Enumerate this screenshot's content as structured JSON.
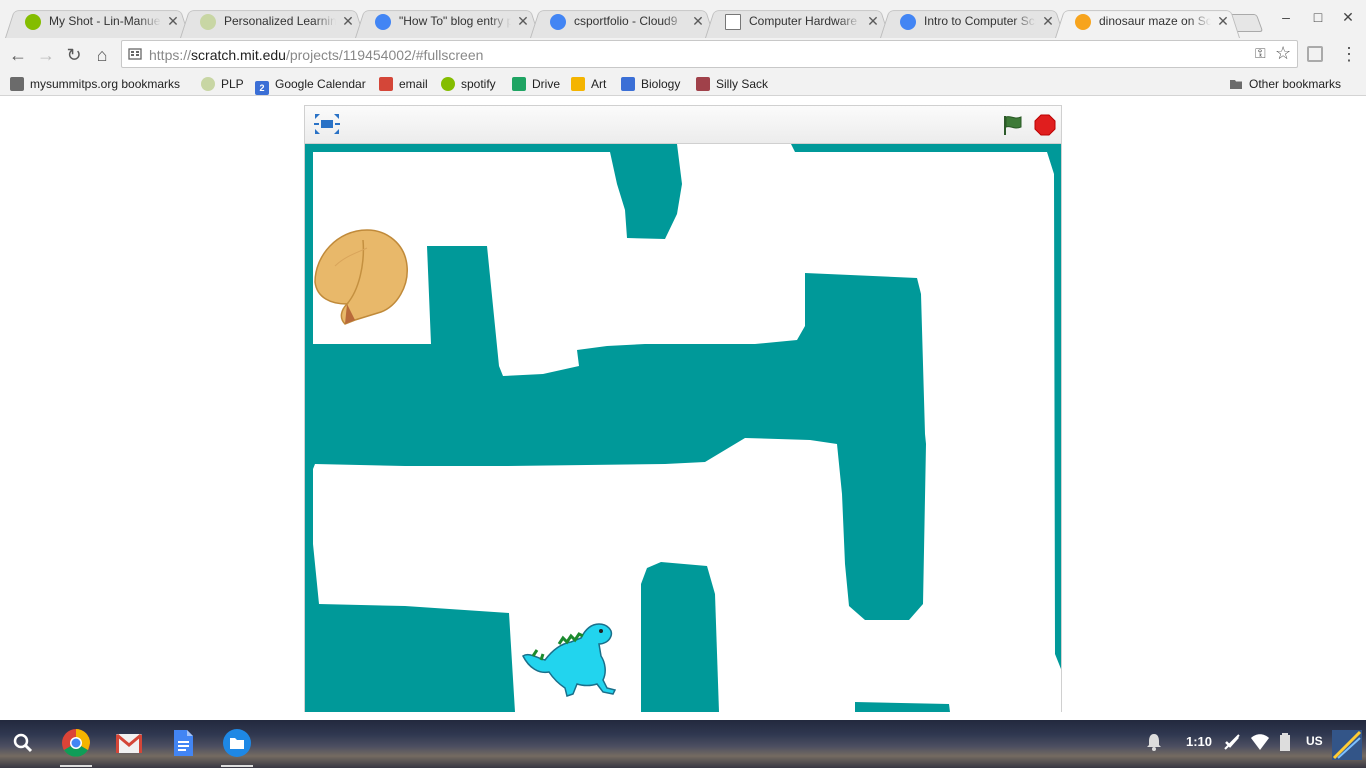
{
  "browser": {
    "tabs": [
      {
        "title": "My Shot - Lin-Manuel Miranda",
        "icon": "spotify-icon",
        "color": "#84bd00",
        "active": false
      },
      {
        "title": "Personalized Learning Plan",
        "icon": "plp-icon",
        "color": "#c8d6a4",
        "active": false
      },
      {
        "title": "\"How To\" blog entry proposal",
        "icon": "docs-icon",
        "color": "#4285f4",
        "active": false
      },
      {
        "title": "csportfolio - Cloud9",
        "icon": "cloud9-icon",
        "color": "#4285f4",
        "active": false
      },
      {
        "title": "Computer Hardware",
        "icon": "page-icon",
        "color": "#ffffff",
        "active": false
      },
      {
        "title": "Intro to Computer Science",
        "icon": "docs-icon",
        "color": "#4285f4",
        "active": false
      },
      {
        "title": "dinosaur maze on Scratch",
        "icon": "scratch-icon",
        "color": "#f7a41d",
        "active": true
      }
    ],
    "close_glyph": "✕",
    "window": {
      "minimize": "–",
      "maximize": "□",
      "close": "✕"
    },
    "nav": {
      "back": "←",
      "forward": "→",
      "reload": "↻",
      "home": "⌂"
    },
    "url": {
      "scheme": "https://",
      "host": "scratch.mit.edu",
      "path": "/projects/119454002/#fullscreen"
    },
    "omnibox_key": "⚿",
    "omnibox_star": "☆",
    "menu": "⋮",
    "bookmarks": [
      {
        "label": "mysummitps.org bookmarks",
        "icon": "folder-icon",
        "color": "#6b6b6b"
      },
      {
        "label": "PLP",
        "icon": "plp-icon",
        "color": "#c8d6a4"
      },
      {
        "label": "Google Calendar",
        "icon": "calendar-icon",
        "color": "#3b6fd6"
      },
      {
        "label": "email",
        "icon": "gmail-icon",
        "color": "#d44638"
      },
      {
        "label": "spotify",
        "icon": "spotify-icon",
        "color": "#84bd00"
      },
      {
        "label": "Drive",
        "icon": "drive-icon",
        "color": "#1fa463"
      },
      {
        "label": "Art",
        "icon": "slides-icon",
        "color": "#f4b400"
      },
      {
        "label": "Biology",
        "icon": "sites-icon",
        "color": "#3b6fd6"
      },
      {
        "label": "Silly Sack",
        "icon": "image-icon",
        "color": "#a0414a"
      }
    ],
    "other_bookmarks": "Other bookmarks",
    "calendar_day": "2"
  },
  "scratch_player": {
    "fullscreen_icon": "fullscreen-toggle-icon",
    "green_flag_icon": "green-flag-icon",
    "stop_icon": "stop-sign-icon",
    "maze_color": "#009999",
    "sprites": [
      "fortune-cookie",
      "cyan-dinosaur"
    ]
  },
  "shelf": {
    "apps": [
      "search-icon",
      "chrome-icon",
      "gmail-icon",
      "docs-icon",
      "files-icon"
    ],
    "time": "1:10",
    "keyboard": "US"
  }
}
